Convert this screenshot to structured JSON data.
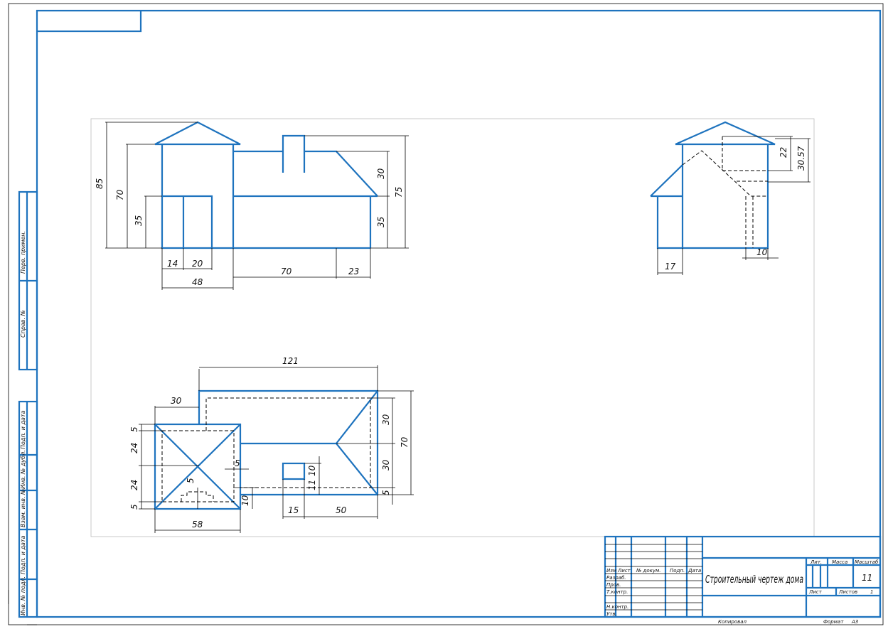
{
  "drawing_title": "Строительный чертеж дома",
  "sheet_number": "11",
  "format_label": "Формат",
  "format_value": "А3",
  "copied_label": "Копировал",
  "sheet_label": "Лист",
  "sheets_label": "Листов",
  "sheets_value": "1",
  "lit_label": "Лит.",
  "mass_label": "Масса",
  "scale_label": "Масштаб",
  "title_block_rows": {
    "col_headers": [
      "Изм",
      "Лист",
      "№ докум.",
      "Подп.",
      "Дата"
    ],
    "roles": [
      "Разраб.",
      "Пров.",
      "Т.контр.",
      "Н.контр.",
      "Утв."
    ]
  },
  "side_stamps": [
    "Перв. примен.",
    "Справ. №",
    "Подп. и дата",
    "Инв. № дубл.",
    "Взам. инв. №",
    "Подп. и дата",
    "Инв. № подл."
  ],
  "front_view_dims": {
    "h85": "85",
    "h70": "70",
    "h35_left": "35",
    "h30": "30",
    "h75": "75",
    "h35_right": "35",
    "w14": "14",
    "w20": "20",
    "w48": "48",
    "w70": "70",
    "w23": "23"
  },
  "side_view_dims": {
    "h22": "22",
    "h30_57": "30.57",
    "w17": "17",
    "w10": "10"
  },
  "plan_view_dims": {
    "w121": "121",
    "w30": "30",
    "h5_top": "5",
    "h24_a": "24",
    "h24_b": "24",
    "h5_bot": "5",
    "w58": "58",
    "h5_mid": "5",
    "h5_inner": "5",
    "h10_left": "10",
    "h10_box": "10",
    "h11": "11",
    "w15": "15",
    "w50": "50",
    "h30_a": "30",
    "h30_b": "30",
    "h70": "70",
    "h5_right": "5"
  }
}
